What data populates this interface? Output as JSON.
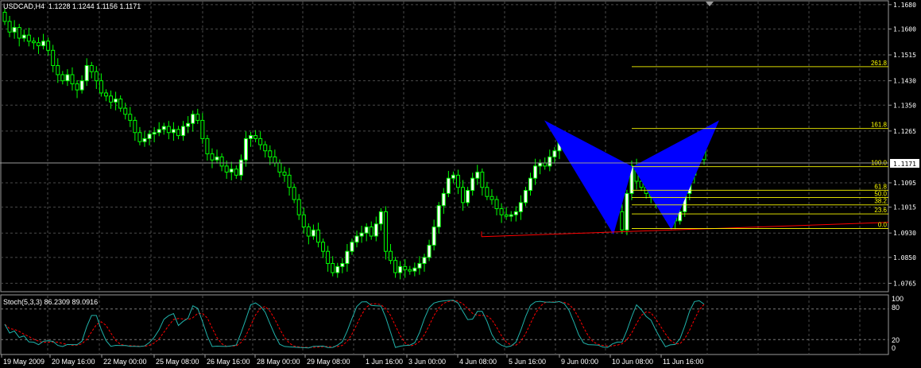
{
  "header": {
    "symbol_tf": "USDCAD,H4",
    "ohlc": "1.1228 1.1244 1.1156 1.1171"
  },
  "indicator": {
    "name_values": "Stoch(5,3,3) 86.2309 89.0916",
    "levels": [
      "100",
      "80",
      "20",
      "0"
    ]
  },
  "price_labels": [
    "1.1680",
    "1.1600",
    "1.1515",
    "1.1430",
    "1.1350",
    "1.1265",
    "1.1095",
    "1.1015",
    "1.0930",
    "1.0850",
    "1.0765"
  ],
  "current_price": "1.1171",
  "time_labels": [
    "19 May 2009",
    "20 May 16:00",
    "22 May 00:00",
    "25 May 08:00",
    "26 May 16:00",
    "28 May 00:00",
    "29 May 08:00",
    "1 Jun 16:00",
    "3 Jun 00:00",
    "4 Jun 08:00",
    "5 Jun 16:00",
    "9 Jun 00:00",
    "10 Jun 08:00",
    "11 Jun 16:00"
  ],
  "fib_levels": [
    "261.8",
    "161.8",
    "100.0",
    "61.8",
    "50.0",
    "38.2",
    "23.6",
    "0.0"
  ],
  "colors": {
    "background": "#000000",
    "grid": "#4a4a4a",
    "candle_up": "#ffffff",
    "candle_down": "#000000",
    "candle_outline": "#00ff00",
    "pattern_fill": "#0000ff",
    "fib_line": "#ffff00",
    "trend_line": "#ff0000",
    "stoch_main": "#20b2aa",
    "stoch_signal": "#ff0000"
  },
  "chart_data": {
    "type": "candlestick",
    "symbol": "USDCAD",
    "timeframe": "H4",
    "ylim": [
      1.074,
      1.169
    ],
    "closes": [
      1.1625,
      1.159,
      1.1605,
      1.157,
      1.158,
      1.156,
      1.1555,
      1.1545,
      1.156,
      1.153,
      1.148,
      1.145,
      1.143,
      1.145,
      1.142,
      1.14,
      1.143,
      1.148,
      1.146,
      1.143,
      1.139,
      1.138,
      1.136,
      1.137,
      1.134,
      1.132,
      1.13,
      1.126,
      1.123,
      1.124,
      1.1255,
      1.126,
      1.127,
      1.128,
      1.126,
      1.127,
      1.125,
      1.128,
      1.129,
      1.132,
      1.13,
      1.124,
      1.119,
      1.117,
      1.118,
      1.115,
      1.113,
      1.114,
      1.112,
      1.117,
      1.124,
      1.125,
      1.124,
      1.122,
      1.12,
      1.118,
      1.116,
      1.113,
      1.112,
      1.108,
      1.104,
      1.099,
      1.095,
      1.092,
      1.094,
      1.09,
      1.087,
      1.083,
      1.08,
      1.082,
      1.083,
      1.087,
      1.09,
      1.092,
      1.093,
      1.095,
      1.092,
      1.096,
      1.1,
      1.087,
      1.084,
      1.08,
      1.082,
      1.081,
      1.0805,
      1.0815,
      1.083,
      1.085,
      1.089,
      1.095,
      1.102,
      1.106,
      1.111,
      1.112,
      1.108,
      1.103,
      1.107,
      1.111,
      1.113,
      1.108,
      1.105,
      1.104,
      1.101,
      1.099,
      1.0985,
      1.099,
      1.1,
      1.103,
      1.107,
      1.111,
      1.115,
      1.116,
      1.115,
      1.118,
      1.12,
      1.124,
      1.123,
      1.12,
      1.117,
      1.115,
      1.114,
      1.115,
      1.112,
      1.106,
      1.1,
      1.098,
      1.102,
      1.1,
      1.094,
      1.106,
      1.115,
      1.11,
      1.108,
      1.106,
      1.105,
      1.104,
      1.101,
      1.099,
      1.1,
      1.097,
      1.1,
      1.106,
      1.112,
      1.118,
      1.123,
      1.1171
    ],
    "fibonacci": {
      "levels": [
        261.8,
        161.8,
        100.0,
        61.8,
        50.0,
        38.2,
        23.6,
        0.0
      ]
    },
    "stochastic": {
      "k": 86.2309,
      "d": 89.0916,
      "levels": [
        100,
        80,
        20,
        0
      ]
    }
  }
}
